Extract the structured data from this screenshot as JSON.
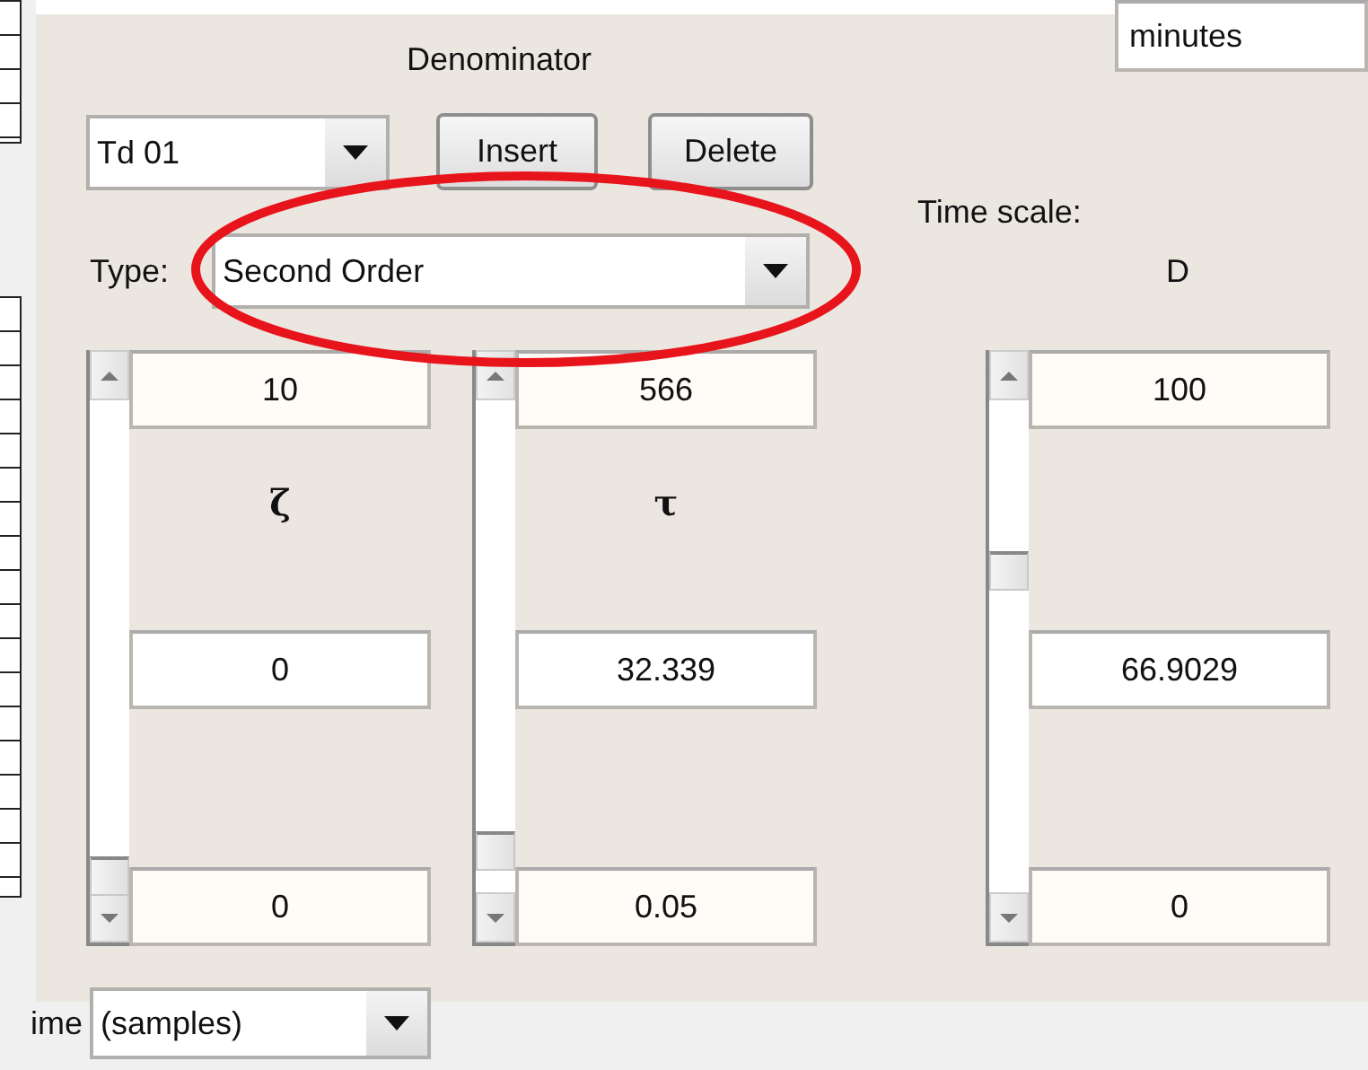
{
  "header": {
    "title": "Denominator"
  },
  "time_unit": {
    "value": "minutes"
  },
  "term": {
    "value": "Td 01"
  },
  "buttons": [
    {
      "label": "Insert"
    },
    {
      "label": "Delete"
    }
  ],
  "time_scale": {
    "label": "Time scale:"
  },
  "type": {
    "label": "Type:",
    "value": "Second Order"
  },
  "parameters": [
    {
      "symbol": "ζ",
      "kind": "column",
      "max": "10",
      "value": "0",
      "min": "0",
      "level": 0
    },
    {
      "symbol": "τ",
      "kind": "column",
      "max": "566",
      "value": "32.339",
      "min": "0.05",
      "level": 0.057
    },
    {
      "symbol": "D",
      "kind": "heading",
      "max": "100",
      "value": "66.9029",
      "min": "0",
      "level": 0.669
    }
  ],
  "time_axis": {
    "label": "ime",
    "value": "(samples)"
  },
  "annotation": {
    "kind": "ellipse"
  }
}
